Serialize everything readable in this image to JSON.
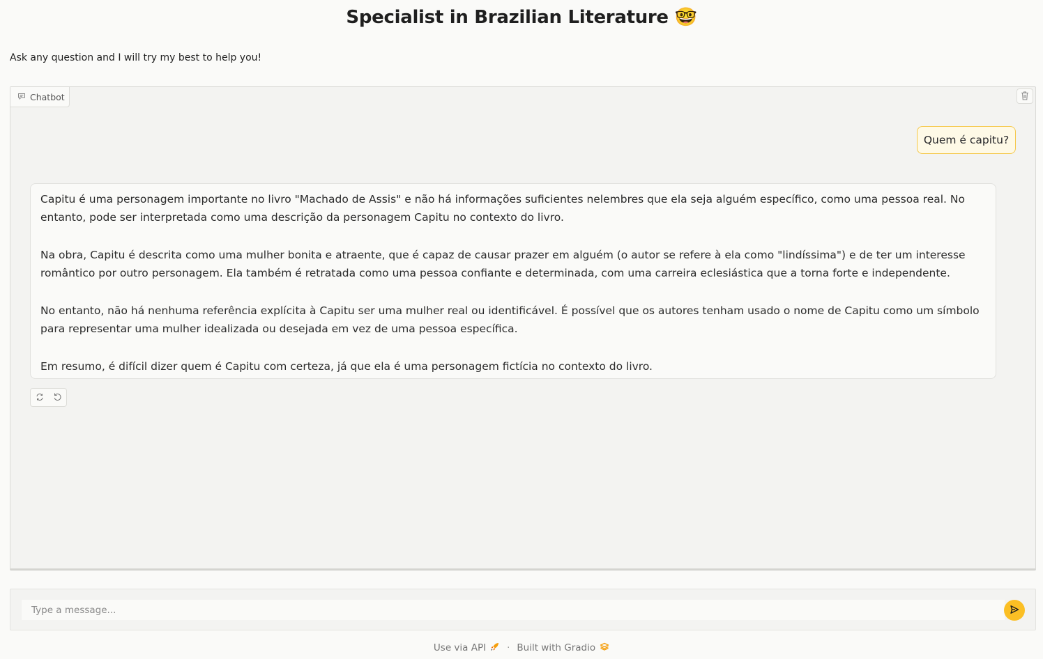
{
  "page": {
    "title": "Specialist in Brazilian Literature 🤓",
    "subtitle": "Ask any question and I will try my best to help you!"
  },
  "chatbot": {
    "label": "Chatbot",
    "messages": {
      "user": "Quem é capitu?",
      "bot": [
        "Capitu é uma personagem importante no livro \"Machado de Assis\" e não há informações suficientes nelembres que ela seja alguém específico, como uma pessoa real. No entanto, pode ser interpretada como uma descrição da personagem Capitu no contexto do livro.",
        "Na obra, Capitu é descrita como uma mulher bonita e atraente, que é capaz de causar prazer em alguém (o autor se refere à ela como \"lindíssima\") e de ter um interesse romântico por outro personagem. Ela também é retratada como uma pessoa confiante e determinada, com uma carreira eclesiástica que a torna forte e independente.",
        "No entanto, não há nenhuma referência explícita à Capitu ser uma mulher real ou identificável. É possível que os autores tenham usado o nome de Capitu como um símbolo para representar uma mulher idealizada ou desejada em vez de uma pessoa específica.",
        "Em resumo, é difícil dizer quem é Capitu com certeza, já que ela é uma personagem fictícia no contexto do livro."
      ]
    },
    "icons": {
      "label_icon": "chat-bubble-icon",
      "clear": "trash-icon",
      "retry": "retry-icon",
      "undo": "undo-icon"
    }
  },
  "input": {
    "placeholder": "Type a message...",
    "value": "",
    "send_icon": "send-icon"
  },
  "footer": {
    "api_label": "Use via API",
    "separator": "·",
    "built_label": "Built with Gradio"
  },
  "colors": {
    "accent": "#fbbf24",
    "user_bubble_bg": "#fef9e6",
    "user_bubble_border": "#f5c84a",
    "background": "#fafaf8"
  }
}
